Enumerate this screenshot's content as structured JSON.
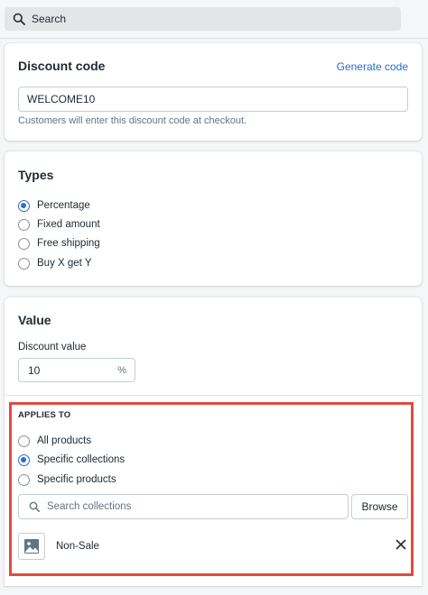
{
  "topbar": {
    "search_placeholder": "Search"
  },
  "discount_code": {
    "title": "Discount code",
    "generate_link": "Generate code",
    "code_value": "WELCOME10",
    "help_text": "Customers will enter this discount code at checkout."
  },
  "types": {
    "title": "Types",
    "options": [
      {
        "label": "Percentage",
        "checked": true
      },
      {
        "label": "Fixed amount",
        "checked": false
      },
      {
        "label": "Free shipping",
        "checked": false
      },
      {
        "label": "Buy X get Y",
        "checked": false
      }
    ]
  },
  "value": {
    "title": "Value",
    "discount_value_label": "Discount value",
    "discount_value": "10",
    "suffix": "%"
  },
  "applies_to": {
    "heading": "APPLIES TO",
    "options": [
      {
        "label": "All products",
        "checked": false
      },
      {
        "label": "Specific collections",
        "checked": true
      },
      {
        "label": "Specific products",
        "checked": false
      }
    ],
    "search_placeholder": "Search collections",
    "browse_label": "Browse",
    "selected_collection": "Non-Sale"
  },
  "colors": {
    "accent": "#2c6ecb",
    "highlight": "#e24a3f"
  }
}
